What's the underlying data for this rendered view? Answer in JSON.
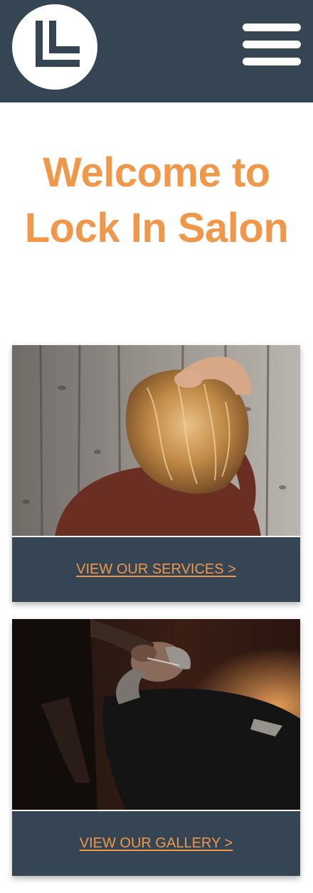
{
  "header": {
    "logo_icon": "ll-monogram-logo",
    "menu_icon": "hamburger-menu-icon",
    "background": "#364554"
  },
  "hero": {
    "title": "Welcome to Lock In Salon",
    "color": "#f0974a"
  },
  "cards": [
    {
      "image_icon": "woman-hair-photo",
      "link_label": "VIEW OUR SERVICES >"
    },
    {
      "image_icon": "barber-shave-photo",
      "link_label": "VIEW OUR GALLERY >"
    }
  ]
}
